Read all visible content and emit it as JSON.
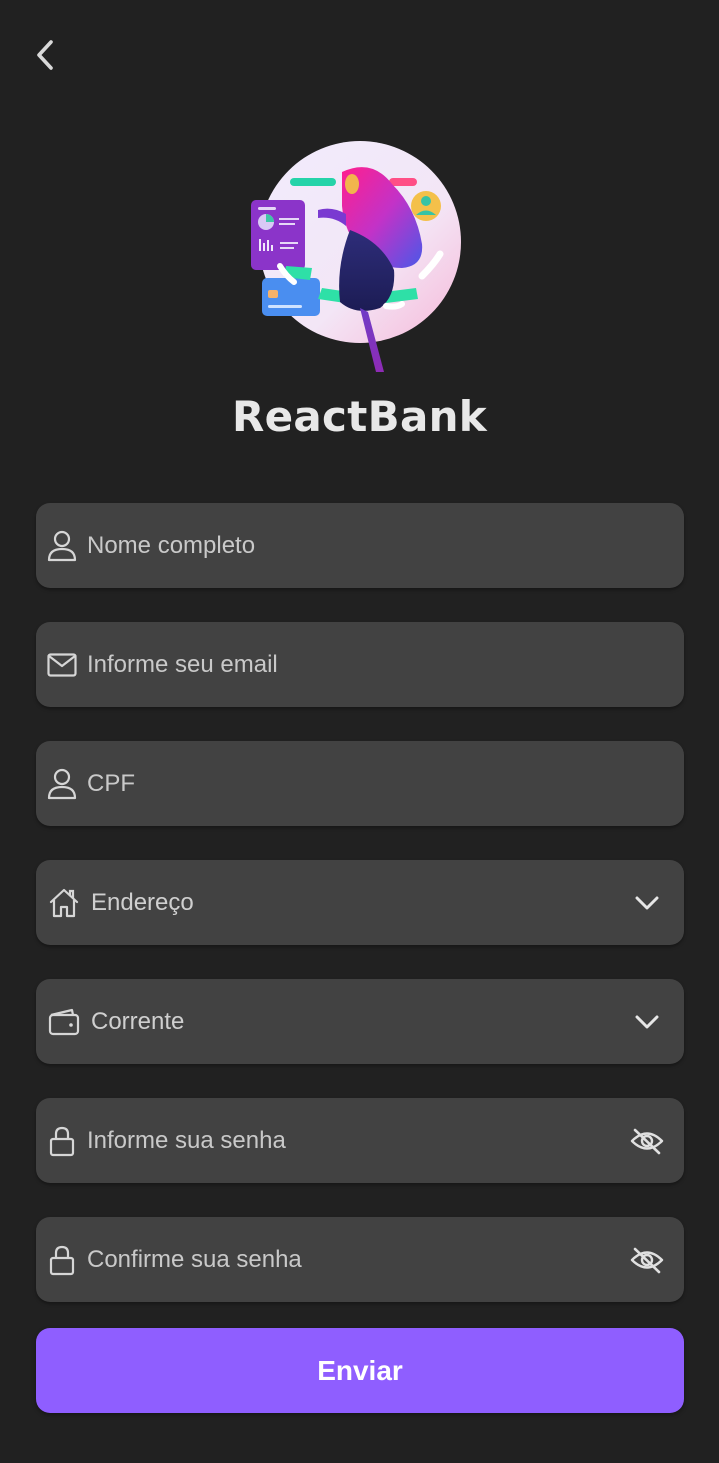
{
  "header": {
    "back_icon": "chevron-left-icon"
  },
  "brand": {
    "name": "ReactBank",
    "logo_icon": "woman-finance-illustration"
  },
  "form": {
    "name_placeholder": "Nome completo",
    "email_placeholder": "Informe seu email",
    "cpf_placeholder": "CPF",
    "address_label": "Endereço",
    "account_type_label": "Corrente",
    "password_placeholder": "Informe sua senha",
    "confirm_password_placeholder": "Confirme sua senha",
    "submit_label": "Enviar"
  },
  "colors": {
    "background": "#212121",
    "field_background": "#424242",
    "accent": "#8f5eff",
    "text": "#e6e6e6"
  }
}
